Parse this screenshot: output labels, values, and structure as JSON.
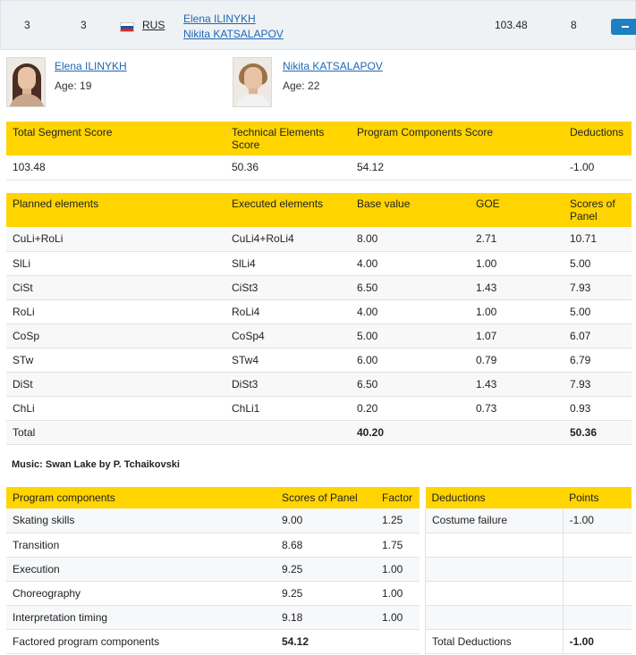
{
  "header": {
    "rank": "3",
    "start_no": "3",
    "nation_code": "RUS",
    "athlete_1": "Elena ILINYKH",
    "athlete_2": "Nikita KATSALAPOV",
    "total": "103.48",
    "place": "8"
  },
  "athletes": [
    {
      "name": "Elena ILINYKH",
      "age": "Age: 19"
    },
    {
      "name": "Nikita KATSALAPOV",
      "age": "Age: 22"
    }
  ],
  "summary": {
    "headers": [
      "Total Segment Score",
      "Technical Elements Score",
      "Program Components Score",
      "Deductions"
    ],
    "values": [
      "103.48",
      "50.36",
      "54.12",
      "-1.00"
    ]
  },
  "elements": {
    "headers": [
      "Planned elements",
      "Executed elements",
      "Base value",
      "GOE",
      "Scores of Panel"
    ],
    "rows": [
      [
        "CuLi+RoLi",
        "CuLi4+RoLi4",
        "8.00",
        "2.71",
        "10.71"
      ],
      [
        "SlLi",
        "SlLi4",
        "4.00",
        "1.00",
        "5.00"
      ],
      [
        "CiSt",
        "CiSt3",
        "6.50",
        "1.43",
        "7.93"
      ],
      [
        "RoLi",
        "RoLi4",
        "4.00",
        "1.00",
        "5.00"
      ],
      [
        "CoSp",
        "CoSp4",
        "5.00",
        "1.07",
        "6.07"
      ],
      [
        "STw",
        "STw4",
        "6.00",
        "0.79",
        "6.79"
      ],
      [
        "DiSt",
        "DiSt3",
        "6.50",
        "1.43",
        "7.93"
      ],
      [
        "ChLi",
        "ChLi1",
        "0.20",
        "0.73",
        "0.93"
      ]
    ],
    "total": [
      "Total",
      "",
      "40.20",
      "",
      "50.36"
    ]
  },
  "music": "Music: Swan Lake by P. Tchaikovski",
  "components": {
    "headers": [
      "Program components",
      "Scores of Panel",
      "Factor"
    ],
    "rows": [
      [
        "Skating skills",
        "9.00",
        "1.25"
      ],
      [
        "Transition",
        "8.68",
        "1.75"
      ],
      [
        "Execution",
        "9.25",
        "1.00"
      ],
      [
        "Choreography",
        "9.25",
        "1.00"
      ],
      [
        "Interpretation timing",
        "9.18",
        "1.00"
      ]
    ],
    "total": [
      "Factored program components",
      "54.12",
      ""
    ]
  },
  "deductions": {
    "headers": [
      "Deductions",
      "Points"
    ],
    "rows": [
      [
        "Costume failure",
        "-1.00"
      ],
      [
        "",
        ""
      ],
      [
        "",
        ""
      ],
      [
        "",
        ""
      ],
      [
        "",
        ""
      ]
    ],
    "total": [
      "Total Deductions",
      "-1.00"
    ]
  },
  "colors": {
    "header_yellow": "#ffd400",
    "link_blue": "#1f66b3",
    "button_blue": "#1f7fc4",
    "row_bg": "#eef2f5"
  },
  "icons": [
    "russia-flag-icon",
    "collapse-icon"
  ]
}
